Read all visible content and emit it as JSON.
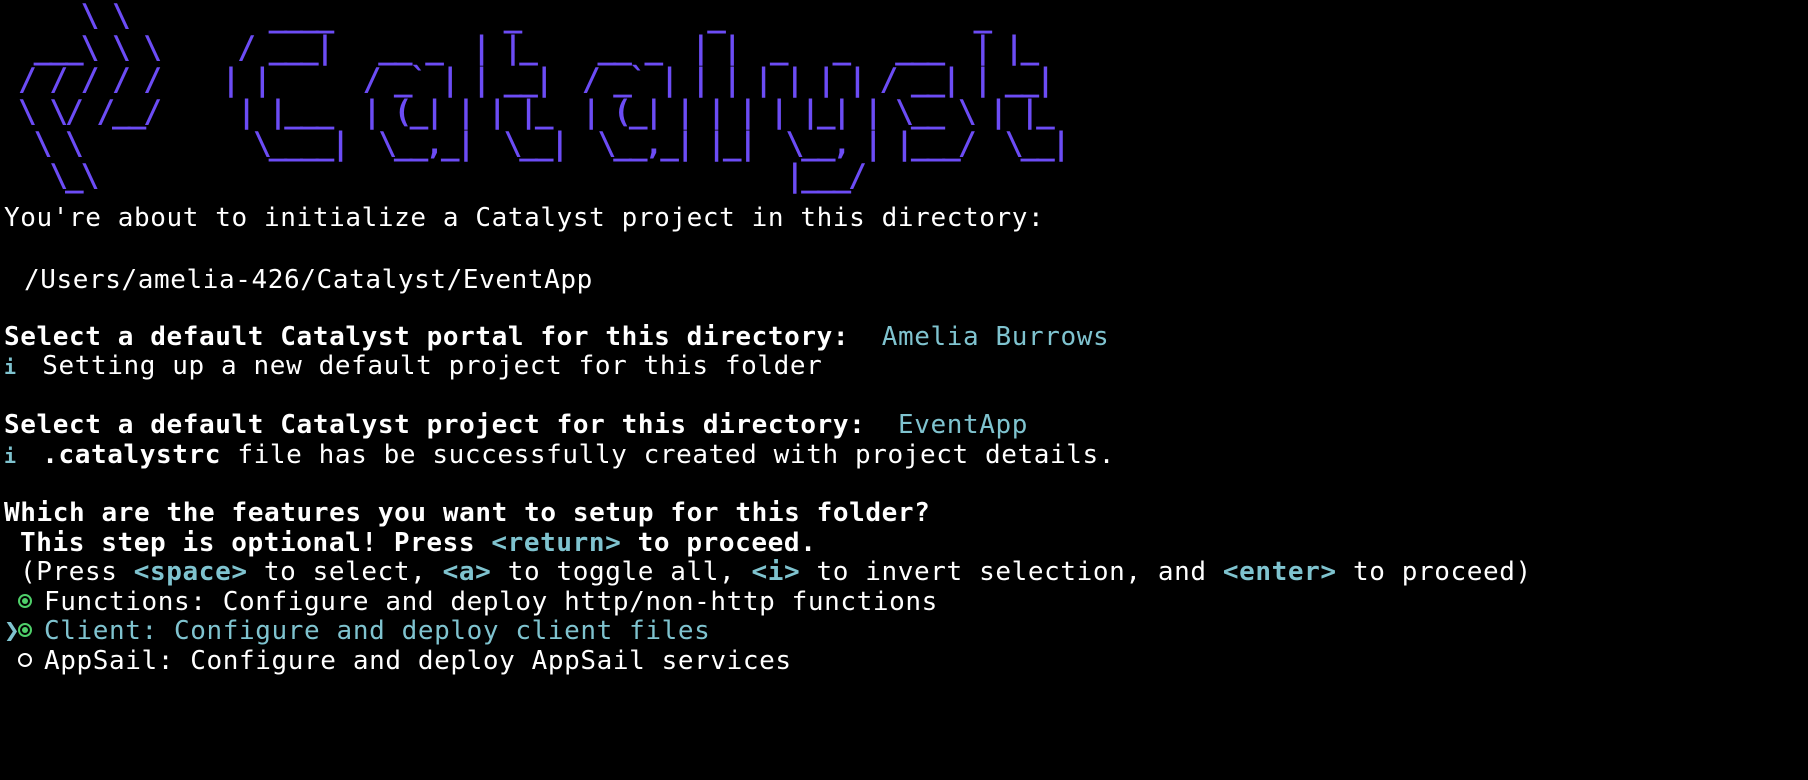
{
  "banner": {
    "ascii": "    \\ \\         ____           _            _                _\n ___\\ \\ \\     / ___|   __ _  | |_    __ _  | |  _   _   ___  | |_\n/ / / / /    | |      / _` | | __|  / _` | | | | | | | / __| | __|\n\\ \\/ /__/     | |___  | (_| | | |_  | (_| | | | | |_| | \\__ \\ | |_\n \\ \\           \\____|  \\__,_|  \\__|  \\__,_| |_|  \\__, | |___/  \\__|\n  \\_\\                                            |___/"
  },
  "intro": {
    "message": "You're about to initialize a Catalyst project in this directory:",
    "path": "/Users/amelia-426/Catalyst/EventApp"
  },
  "portal": {
    "prompt": "Select a default Catalyst portal for this directory:",
    "answer": "Amelia Burrows",
    "info_icon": "i",
    "info": "Setting up a new default project for this folder"
  },
  "project": {
    "prompt": "Select a default Catalyst project for this directory:",
    "answer": "EventApp",
    "info_icon": "i",
    "info_file": ".catalystrc",
    "info_rest": "file has be successfully created with project details."
  },
  "features": {
    "question": "Which are the features you want to setup for this folder?",
    "optional_pre": "This step is optional! Press",
    "optional_key": "<return>",
    "optional_post": "to proceed.",
    "help": {
      "p1": "(Press",
      "k1": "<space>",
      "p2": "to select,",
      "k2": "<a>",
      "p3": "to toggle all,",
      "k3": "<i>",
      "p4": "to invert selection, and",
      "k4": "<enter>",
      "p5": "to proceed)"
    },
    "pointer_icon": "❯",
    "options": [
      {
        "label": "Functions: Configure and deploy http/non-http functions",
        "selected": true,
        "focused": false
      },
      {
        "label": "Client: Configure and deploy client files",
        "selected": true,
        "focused": true
      },
      {
        "label": "AppSail: Configure and deploy AppSail services",
        "selected": false,
        "focused": false
      }
    ]
  }
}
